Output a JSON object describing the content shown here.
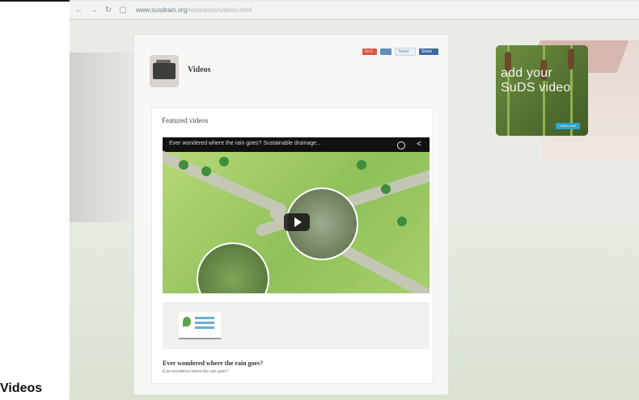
{
  "browser": {
    "url_host": "www.susdrain.org",
    "url_path": "/resources/videos.html"
  },
  "page": {
    "title": "Videos",
    "featured_heading": "Featured videos",
    "share": {
      "gplus": "G+1",
      "tweet": "Tweet",
      "share": "Share"
    }
  },
  "video": {
    "title": "Ever wondered where the rain goes? Sustainable drainage...",
    "caption": "Ever wondered where the rain goes?",
    "subcaption": "Ever wondered where the rain goes?"
  },
  "ad": {
    "text": "add your SuDS video",
    "button": "Learn more"
  },
  "figure_caption": "Videos",
  "colors": {
    "ad_button": "#2ea4c9",
    "share_blue": "#3b6aa6"
  }
}
